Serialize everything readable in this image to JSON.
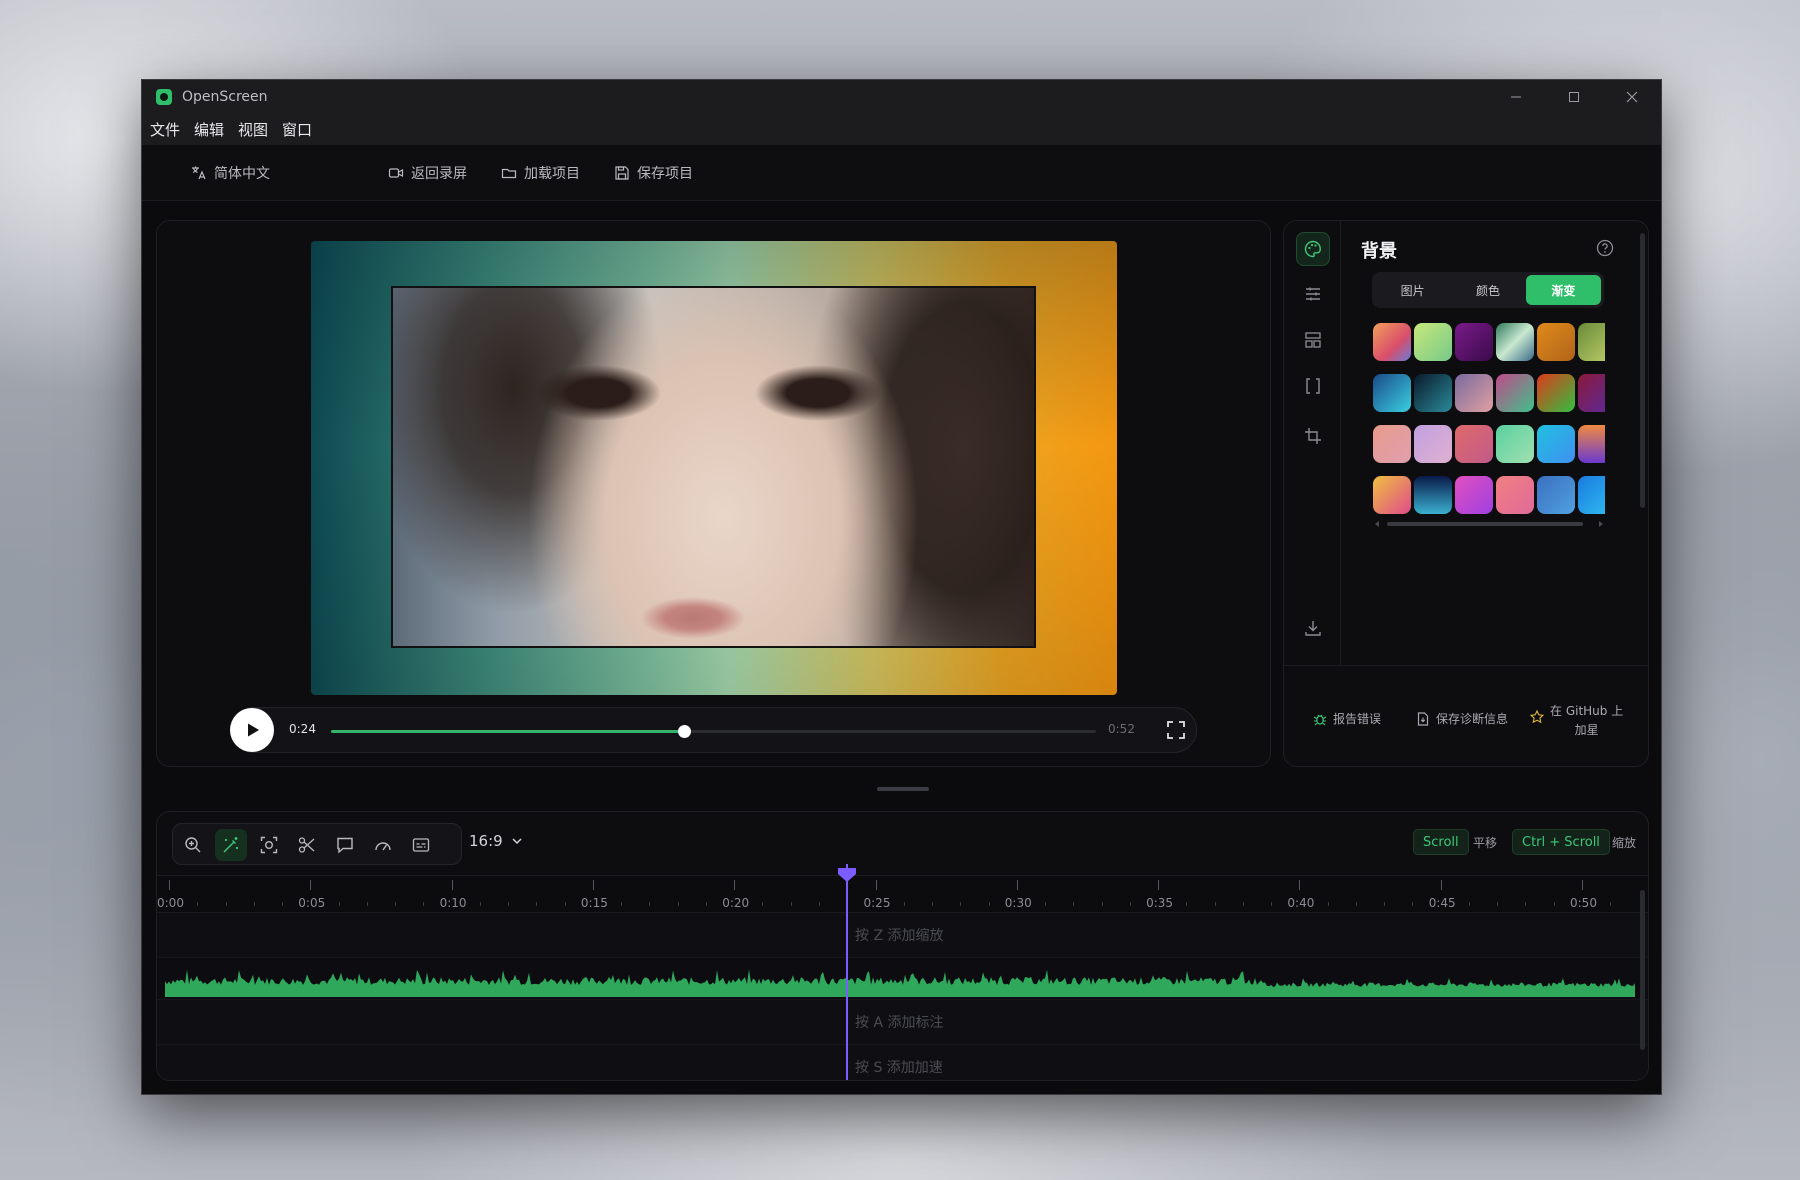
{
  "window": {
    "title": "OpenScreen"
  },
  "menu": [
    "文件",
    "编辑",
    "视图",
    "窗口"
  ],
  "toolbar": {
    "language": "简体中文",
    "back_to_record": "返回录屏",
    "load_project": "加载项目",
    "save_project": "保存项目"
  },
  "player": {
    "current_time": "0:24",
    "duration": "0:52",
    "progress": 0.4615
  },
  "background_panel": {
    "title": "背景",
    "tabs": [
      {
        "label": "图片",
        "active": false
      },
      {
        "label": "颜色",
        "active": false
      },
      {
        "label": "渐变",
        "active": true
      }
    ],
    "gradients": [
      [
        "linear-gradient(135deg,#f2a05a,#d94e6a 60%,#6a7bd8)",
        "linear-gradient(135deg,#c8e87a,#77c98a)",
        "linear-gradient(135deg,#7a1a8a,#3a0b4a)",
        "linear-gradient(135deg,#2f7a5a,#c9e8d0 50%,#3a6a8a)",
        "linear-gradient(135deg,#e08a1a,#b0641a)",
        "linear-gradient(135deg,#6a8a3a,#c0d06a)"
      ],
      [
        "linear-gradient(135deg,#1a4a8a,#3ad0e0)",
        "linear-gradient(135deg,#0a1a2a,#2a8a9a)",
        "linear-gradient(135deg,#7a6aa0,#e0a0a0)",
        "linear-gradient(135deg,#c04a8a,#40c08a)",
        "linear-gradient(135deg,#e03a1a,#30c040)",
        "linear-gradient(135deg,#8a1a3a,#5a2aa0)"
      ],
      [
        "linear-gradient(135deg,#e89a8a,#e0a0b0)",
        "linear-gradient(135deg,#c0a0e0,#e0b0d0)",
        "linear-gradient(135deg,#e06a6a,#c05a8a)",
        "linear-gradient(135deg,#5ad0a0,#a0e0b0)",
        "linear-gradient(135deg,#20c0e0,#4090f0)",
        "linear-gradient(180deg,#f08a40,#6a3ad0)"
      ],
      [
        "linear-gradient(135deg,#f0c040,#e04a8a)",
        "linear-gradient(180deg,#0a1a4a,#3ab0d0)",
        "linear-gradient(135deg,#e050c0,#a040e0)",
        "linear-gradient(135deg,#f08080,#e06a9a)",
        "linear-gradient(135deg,#3a70c0,#50a0e0)",
        "linear-gradient(135deg,#1a7ae0,#30c0f0)"
      ]
    ]
  },
  "footer": {
    "report_bug": "报告错误",
    "save_diagnostics": "保存诊断信息",
    "github_star_line1": "在 GitHub 上",
    "github_star_line2": "加星"
  },
  "timeline": {
    "aspect_ratio": "16:9",
    "scroll_key": "Scroll",
    "scroll_label": "平移",
    "zoom_key": "Ctrl + Scroll",
    "zoom_label": "缩放",
    "ticks": [
      "0:00",
      "0:05",
      "0:10",
      "0:15",
      "0:20",
      "0:25",
      "0:30",
      "0:35",
      "0:40",
      "0:45",
      "0:50"
    ],
    "playhead_time_sec": 24,
    "lane_hints": {
      "zoom": "按 Z 添加缩放",
      "annotation": "按 A 添加标注",
      "speed": "按 S 添加加速"
    }
  },
  "colors": {
    "accent": "#2fbf6a",
    "playhead": "#7d5cff",
    "waveform": "#2fa85c"
  },
  "icons": [
    "translate-icon",
    "camera-icon",
    "folder-icon",
    "save-icon",
    "palette-icon",
    "sliders-icon",
    "layout-icon",
    "brackets-icon",
    "crop-icon",
    "download-icon",
    "help-icon",
    "bug-icon",
    "file-icon",
    "star-icon",
    "zoom-icon",
    "magic-wand-icon",
    "focus-icon",
    "scissors-icon",
    "comment-icon",
    "speed-icon",
    "caption-icon",
    "chevron-down-icon",
    "play-icon",
    "fullscreen-icon"
  ]
}
